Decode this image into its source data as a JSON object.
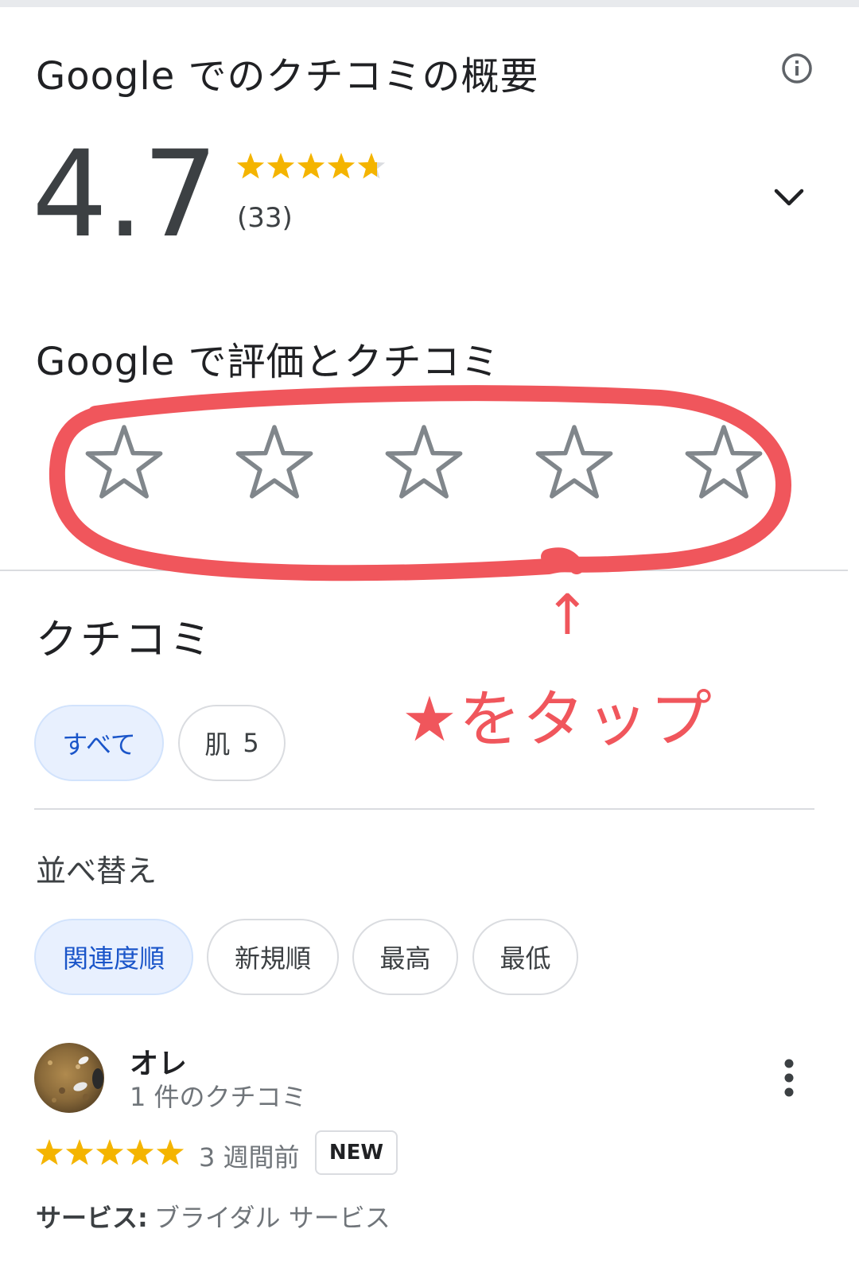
{
  "summary": {
    "title": "Google でのクチコミの概要",
    "rating": "4.7",
    "rating_value": 4.7,
    "stars_max": 5,
    "review_count": "(33)",
    "info_icon": "info-icon",
    "expand_icon": "chevron-down-icon"
  },
  "rate": {
    "title": "Google で評価とクチコミ",
    "star_count": 5,
    "star_icon": "star-outline-icon"
  },
  "reviews": {
    "heading": "クチコミ",
    "filters": [
      {
        "label": "すべて",
        "count": "",
        "selected": true
      },
      {
        "label": "肌",
        "count": "5",
        "selected": false
      }
    ],
    "sort_label": "並べ替え",
    "sort_options": [
      {
        "label": "関連度順",
        "selected": true
      },
      {
        "label": "新規順",
        "selected": false
      },
      {
        "label": "最高",
        "selected": false
      },
      {
        "label": "最低",
        "selected": false
      }
    ]
  },
  "review": {
    "name": "オレ",
    "subtitle": "1 件のクチコミ",
    "stars": 5,
    "time": "3 週間前",
    "badge": "NEW",
    "service_key": "サービス:",
    "service_value": "ブライダル サービス",
    "more_icon": "more-vert-icon"
  },
  "annotation": {
    "arrow": "↑",
    "text": "★をタップ",
    "color": "#f0565c"
  },
  "colors": {
    "star_gold": "#f4b400",
    "star_gray": "#dadce0",
    "outline_star": "#80868b",
    "selected_chip_bg": "#e8f0fe",
    "selected_chip_text": "#1a55c9"
  }
}
